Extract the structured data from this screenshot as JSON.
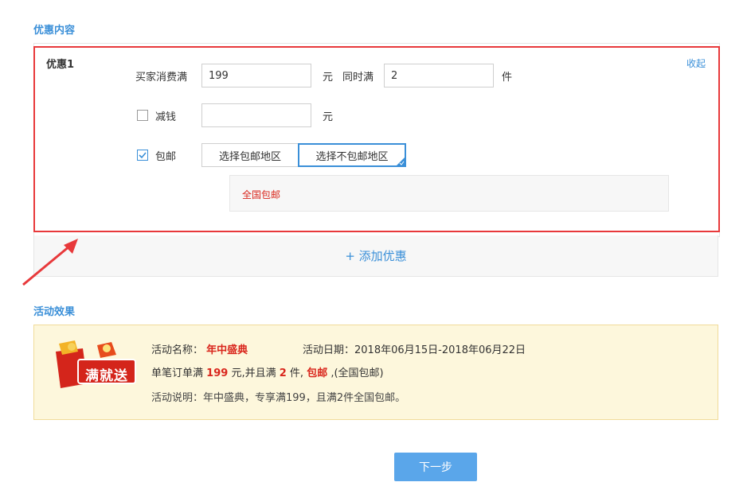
{
  "sections": {
    "promo_title": "优惠内容",
    "effect_title": "活动效果"
  },
  "promo": {
    "name": "优惠1",
    "collapse": "收起",
    "buyer_spend_label": "买家消费满",
    "spend_value": "199",
    "yuan": "元",
    "meanwhile_label": "同时满",
    "qty_value": "2",
    "unit_piece": "件",
    "discount_label": "减钱",
    "discount_value": "",
    "discount_checked": false,
    "free_ship_label": "包邮",
    "free_ship_checked": true,
    "btn_select_region": "选择包邮地区",
    "btn_select_excluded": "选择不包邮地区",
    "region_text": "全国包邮"
  },
  "add_promo": "+ 添加优惠",
  "effect": {
    "badge_text": "满就送",
    "name_label": "活动名称：",
    "name_value": "年中盛典",
    "date_label": "活动日期：",
    "date_value": "2018年06月15日-2018年06月22日",
    "rule_prefix": "单笔订单满",
    "rule_amount": "199",
    "rule_mid": "元,并且满",
    "rule_qty": "2",
    "rule_unit": "件,",
    "rule_free": "包邮",
    "rule_suffix": ",(全国包邮)",
    "desc_label": "活动说明：",
    "desc_value": "年中盛典，专享满199，且满2件全国包邮。"
  },
  "next_button": "下一步",
  "colors": {
    "accent": "#3a8fd8",
    "highlight": "#e8393b",
    "price": "#d9261c"
  }
}
